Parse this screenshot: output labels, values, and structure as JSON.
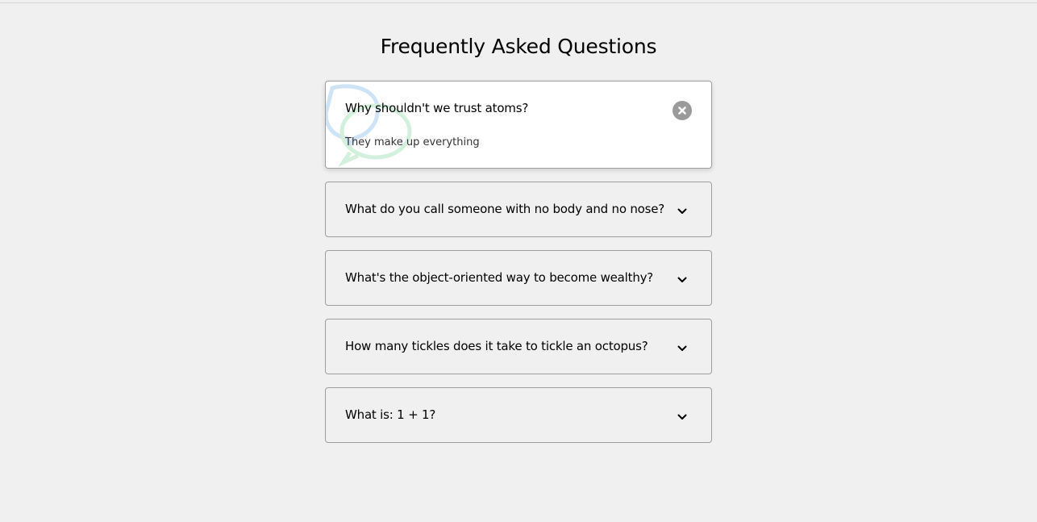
{
  "page": {
    "title": "Frequently Asked Questions"
  },
  "faqs": [
    {
      "question": "Why shouldn't we trust atoms?",
      "answer": "They make up everything",
      "state": "open",
      "toggle_icon": "close-icon"
    },
    {
      "question": "What do you call someone with no body and no nose?",
      "state": "closed",
      "toggle_icon": "chevron-down-icon"
    },
    {
      "question": "What's the object-oriented way to become wealthy?",
      "state": "closed",
      "toggle_icon": "chevron-down-icon"
    },
    {
      "question": "How many tickles does it take to tickle an octopus?",
      "state": "closed",
      "toggle_icon": "chevron-down-icon"
    },
    {
      "question": "What is: 1 + 1?",
      "state": "closed",
      "toggle_icon": "chevron-down-icon"
    }
  ],
  "colors": {
    "background": "#f0f0f0",
    "card_border": "#9e9e9e",
    "active_card": "#ffffff",
    "close_button": "#9a9a9a",
    "bubble_blue": "#cfe3f7",
    "bubble_green": "#d2f0dc"
  }
}
